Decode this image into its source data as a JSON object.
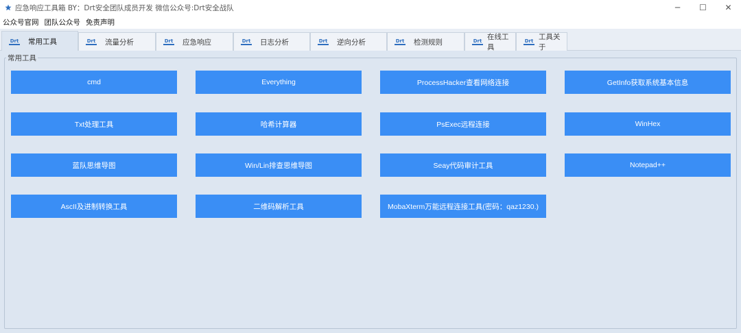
{
  "window": {
    "title": "应急响应工具箱   BY：Drt安全团队成员开发    微信公众号:Drt安全战队",
    "app_icon": "star-icon",
    "controls": {
      "minimize": "─",
      "maximize": "☐",
      "close": "✕"
    }
  },
  "menu": [
    "公众号官网",
    "团队公众号",
    "免责声明"
  ],
  "tabs": [
    {
      "label": "常用工具",
      "logo": "Drt"
    },
    {
      "label": "流量分析",
      "logo": "Drt"
    },
    {
      "label": "应急响应",
      "logo": "Drt"
    },
    {
      "label": "日志分析",
      "logo": "Drt"
    },
    {
      "label": "逆向分析",
      "logo": "Drt"
    },
    {
      "label": "检测规则",
      "logo": "Drt"
    },
    {
      "label": "在线工具",
      "logo": "Drt"
    },
    {
      "label": "工具关于",
      "logo": "Drt"
    }
  ],
  "active_tab": "常用工具",
  "group": {
    "title": "常用工具",
    "buttons": [
      "cmd",
      "Everything",
      "ProcessHacker查看网络连接",
      "GetInfo获取系统基本信息",
      "Txt处理工具",
      "哈希计算器",
      "PsExec远程连接",
      "WinHex",
      "蓝队思维导图",
      "Win/Lin排查思维导图",
      "Seay代码审计工具",
      "Notepad++",
      "AscII及进制转换工具",
      "二维码解析工具",
      "MobaXterm万能远程连接工具(密码：qaz1230.)"
    ]
  },
  "colors": {
    "button_bg": "#3a8ef5",
    "content_bg": "#dde6f1",
    "logo": "#2f6fbf"
  }
}
